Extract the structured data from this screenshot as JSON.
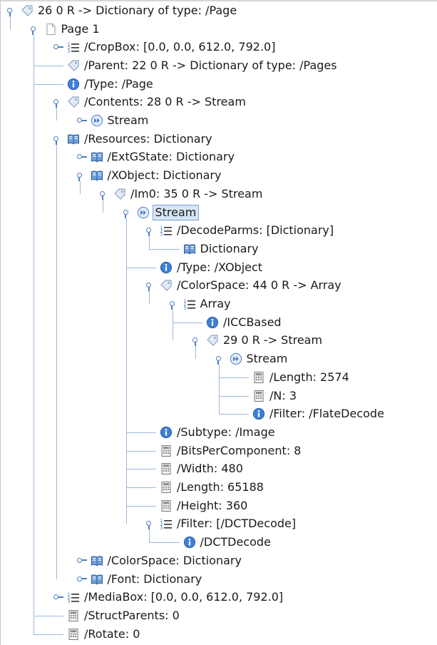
{
  "tree": {
    "rows": [
      {
        "label": "26 0 R -> Dictionary of type: /Page",
        "icon": "tag-icon",
        "toggle": "expanded",
        "depth": 0
      },
      {
        "label": "Page 1",
        "icon": "page-icon",
        "toggle": "expanded",
        "depth": 1
      },
      {
        "label": "/CropBox: [0.0, 0.0, 612.0, 792.0]",
        "icon": "list-icon",
        "toggle": "collapsed",
        "depth": 2
      },
      {
        "label": "/Parent: 22 0 R -> Dictionary of type: /Pages",
        "icon": "tag-icon",
        "toggle": "none",
        "depth": 2
      },
      {
        "label": "/Type: /Page",
        "icon": "info-icon",
        "toggle": "none",
        "depth": 2
      },
      {
        "label": "/Contents: 28 0 R -> Stream",
        "icon": "tag-icon",
        "toggle": "expanded",
        "depth": 2
      },
      {
        "label": "Stream",
        "icon": "stream-icon",
        "toggle": "collapsed",
        "depth": 3
      },
      {
        "label": "/Resources: Dictionary",
        "icon": "book-icon",
        "toggle": "expanded",
        "depth": 2
      },
      {
        "label": "/ExtGState: Dictionary",
        "icon": "book-icon",
        "toggle": "collapsed",
        "depth": 3
      },
      {
        "label": "/XObject: Dictionary",
        "icon": "book-icon",
        "toggle": "expanded",
        "depth": 3
      },
      {
        "label": "/Im0: 35 0 R -> Stream",
        "icon": "tag-icon",
        "toggle": "expanded",
        "depth": 4
      },
      {
        "label": "Stream",
        "icon": "stream-icon",
        "toggle": "expanded",
        "depth": 5,
        "selected": true
      },
      {
        "label": "/DecodeParms: [Dictionary]",
        "icon": "list-icon",
        "toggle": "expanded",
        "depth": 6
      },
      {
        "label": "Dictionary",
        "icon": "book-icon",
        "toggle": "none",
        "depth": 7
      },
      {
        "label": "/Type: /XObject",
        "icon": "info-icon",
        "toggle": "none",
        "depth": 6
      },
      {
        "label": "/ColorSpace: 44 0 R -> Array",
        "icon": "tag-icon",
        "toggle": "expanded",
        "depth": 6
      },
      {
        "label": "Array",
        "icon": "list-icon",
        "toggle": "expanded",
        "depth": 7
      },
      {
        "label": "/ICCBased",
        "icon": "info-icon",
        "toggle": "none",
        "depth": 8
      },
      {
        "label": "29 0 R -> Stream",
        "icon": "tag-icon",
        "toggle": "expanded",
        "depth": 8
      },
      {
        "label": "Stream",
        "icon": "stream-icon",
        "toggle": "expanded",
        "depth": 9
      },
      {
        "label": "/Length: 2574",
        "icon": "calculator-icon",
        "toggle": "none",
        "depth": 10
      },
      {
        "label": "/N: 3",
        "icon": "calculator-icon",
        "toggle": "none",
        "depth": 10
      },
      {
        "label": "/Filter: /FlateDecode",
        "icon": "info-icon",
        "toggle": "none",
        "depth": 10
      },
      {
        "label": "/Subtype: /Image",
        "icon": "info-icon",
        "toggle": "none",
        "depth": 6
      },
      {
        "label": "/BitsPerComponent: 8",
        "icon": "calculator-icon",
        "toggle": "none",
        "depth": 6
      },
      {
        "label": "/Width: 480",
        "icon": "calculator-icon",
        "toggle": "none",
        "depth": 6
      },
      {
        "label": "/Length: 65188",
        "icon": "calculator-icon",
        "toggle": "none",
        "depth": 6
      },
      {
        "label": "/Height: 360",
        "icon": "calculator-icon",
        "toggle": "none",
        "depth": 6
      },
      {
        "label": "/Filter: [/DCTDecode]",
        "icon": "list-icon",
        "toggle": "expanded",
        "depth": 6
      },
      {
        "label": "/DCTDecode",
        "icon": "info-icon",
        "toggle": "none",
        "depth": 7
      },
      {
        "label": "/ColorSpace: Dictionary",
        "icon": "book-icon",
        "toggle": "collapsed",
        "depth": 3
      },
      {
        "label": "/Font: Dictionary",
        "icon": "book-icon",
        "toggle": "collapsed",
        "depth": 3
      },
      {
        "label": "/MediaBox: [0.0, 0.0, 612.0, 792.0]",
        "icon": "list-icon",
        "toggle": "collapsed",
        "depth": 2
      },
      {
        "label": "/StructParents: 0",
        "icon": "calculator-icon",
        "toggle": "none",
        "depth": 2
      },
      {
        "label": "/Rotate: 0",
        "icon": "calculator-icon",
        "toggle": "none",
        "depth": 2
      }
    ]
  },
  "colors": {
    "connector": "#9fb8d8",
    "toggle": "#4c7fc0",
    "selection": "#d7e6f6",
    "selection_border": "#7aa3d3"
  }
}
